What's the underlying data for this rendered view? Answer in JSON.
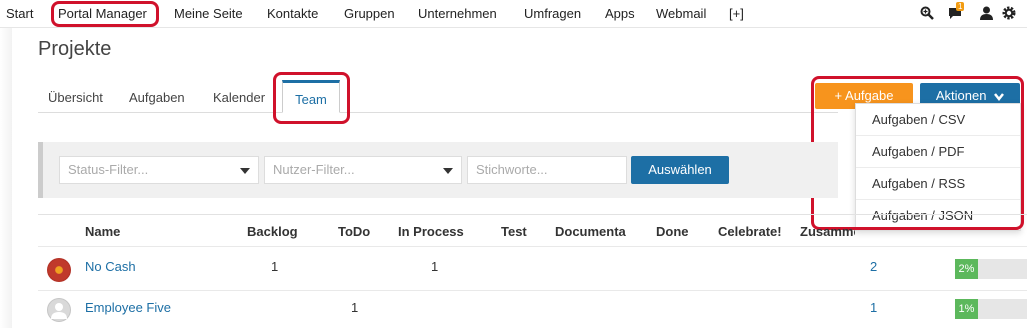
{
  "topnav": {
    "items": [
      "Start",
      "Portal Manager",
      "Meine Seite",
      "Kontakte",
      "Gruppen",
      "Unternehmen",
      "Umfragen",
      "Apps",
      "Webmail",
      "[+]"
    ],
    "notification_count": "1",
    "icons": [
      "search-icon",
      "chat-icon",
      "user-icon",
      "gear-icon"
    ]
  },
  "page": {
    "title": "Projekte"
  },
  "tabs": [
    "Übersicht",
    "Aufgaben",
    "Kalender",
    "Team"
  ],
  "actions": {
    "add_task_label": "+ Aufgabe",
    "actions_label": "Aktionen",
    "menu": [
      "Aufgaben / CSV",
      "Aufgaben / PDF",
      "Aufgaben / RSS",
      "Aufgaben / JSON"
    ]
  },
  "filters": {
    "status_placeholder": "Status-Filter...",
    "user_placeholder": "Nutzer-Filter...",
    "keyword_placeholder": "Stichworte...",
    "submit_label": "Auswählen"
  },
  "table": {
    "headers": [
      "Name",
      "Backlog",
      "ToDo",
      "In Process",
      "Test",
      "Documenta",
      "Done",
      "Celebrate!",
      "Zusammenfassung"
    ],
    "rows": [
      {
        "name": "No Cash",
        "backlog": "1",
        "todo": "",
        "in_process": "1",
        "summary": "2",
        "progress": 2,
        "progress_label": "2%"
      },
      {
        "name": "Employee Five",
        "backlog": "",
        "todo": "1",
        "in_process": "",
        "summary": "1",
        "progress": 1,
        "progress_label": "1%"
      }
    ]
  },
  "colors": {
    "accent": "#1d6fa5",
    "orange": "#f7941d",
    "highlight": "#d0112b",
    "progress": "#5cb85c"
  }
}
